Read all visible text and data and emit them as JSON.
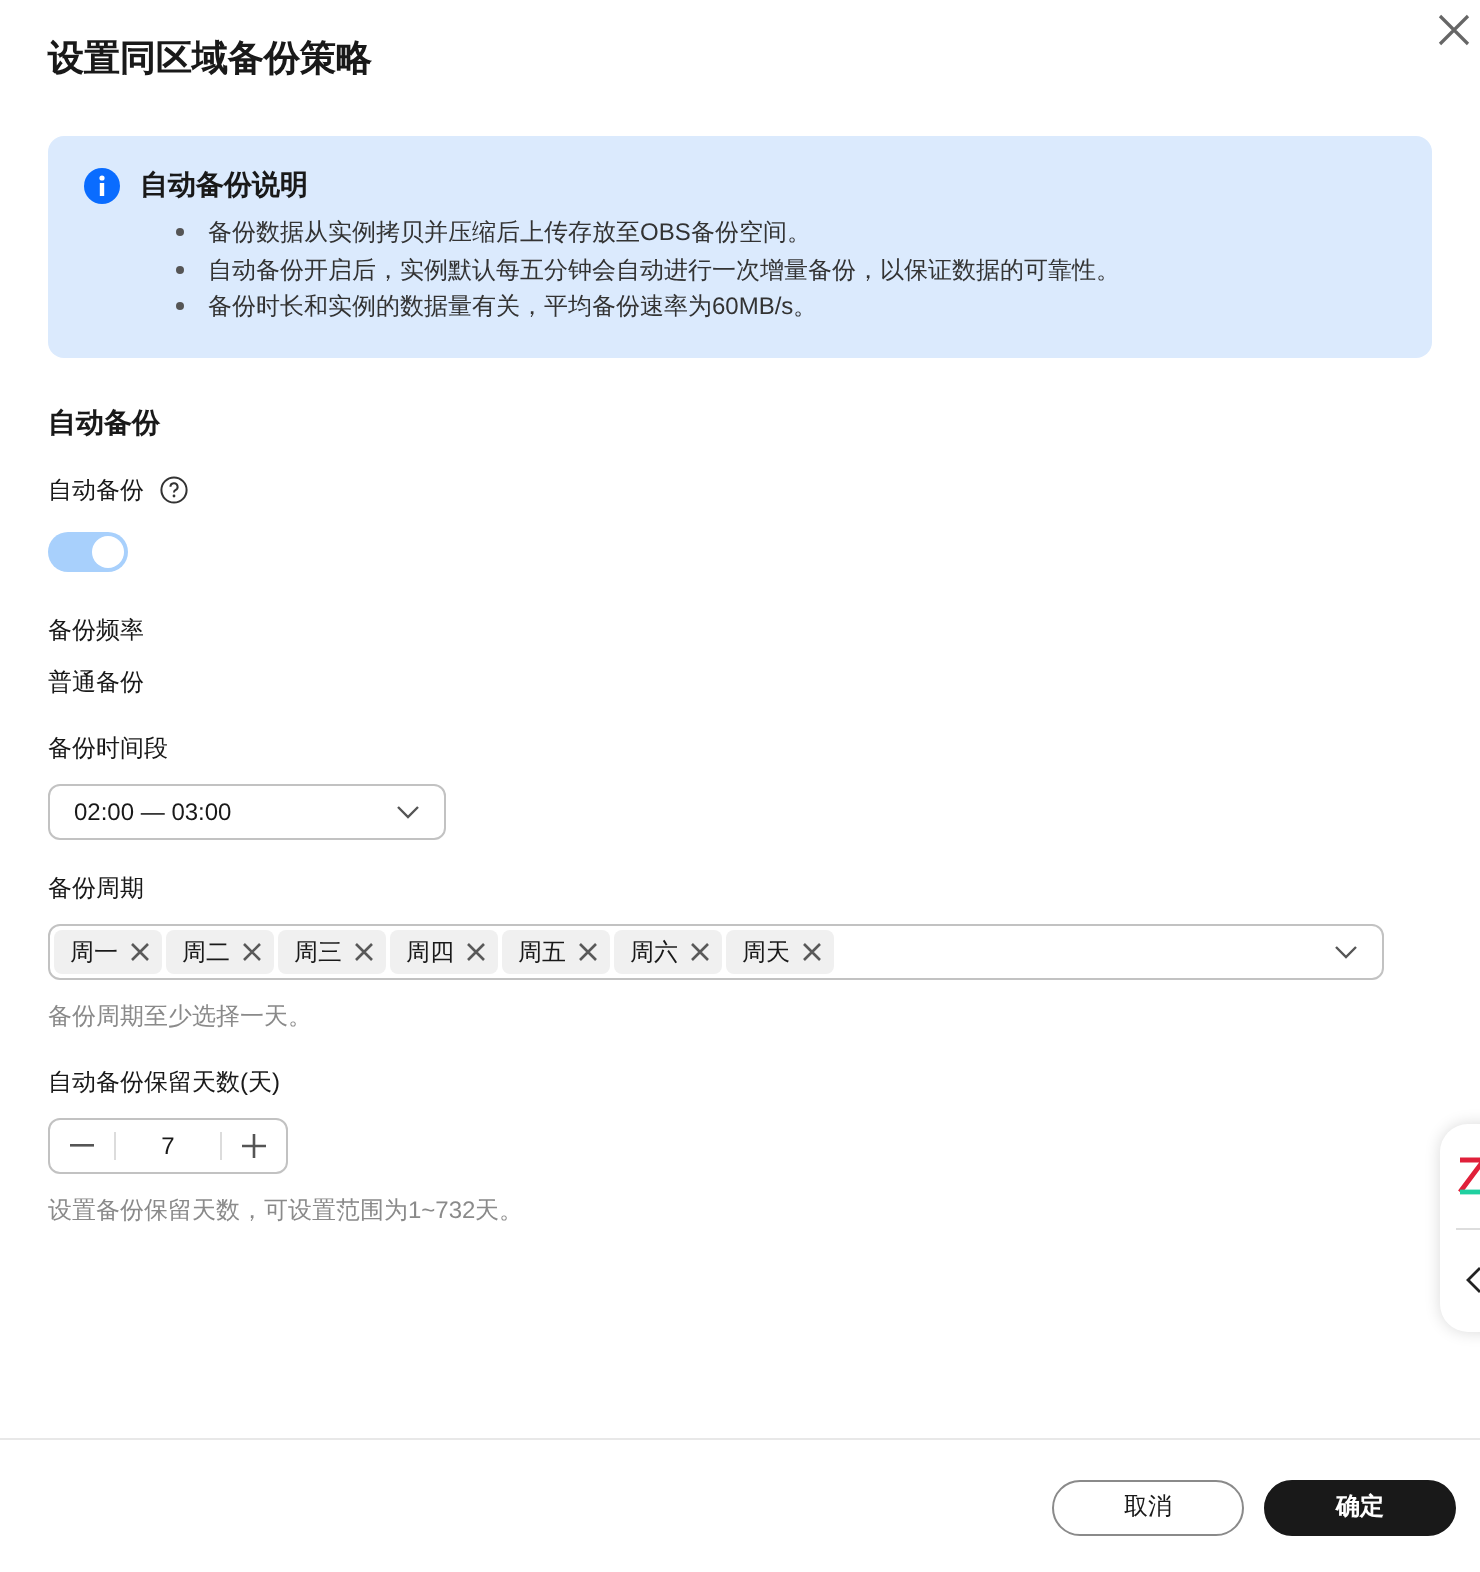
{
  "dialog": {
    "title": "设置同区域备份策略"
  },
  "notice": {
    "title": "自动备份说明",
    "items": [
      "备份数据从实例拷贝并压缩后上传存放至OBS备份空间。",
      "自动备份开启后，实例默认每五分钟会自动进行一次增量备份，以保证数据的可靠性。",
      "备份时长和实例的数据量有关，平均备份速率为60MB/s。"
    ]
  },
  "section": {
    "title": "自动备份"
  },
  "auto_backup": {
    "label": "自动备份",
    "on": true
  },
  "frequency": {
    "label": "备份频率",
    "value": "普通备份"
  },
  "time_window": {
    "label": "备份时间段",
    "value": "02:00 — 03:00"
  },
  "period": {
    "label": "备份周期",
    "tags": [
      "周一",
      "周二",
      "周三",
      "周四",
      "周五",
      "周六",
      "周天"
    ],
    "hint": "备份周期至少选择一天。"
  },
  "retention": {
    "label": "自动备份保留天数(天)",
    "value": "7",
    "hint": "设置备份保留天数，可设置范围为1~732天。"
  },
  "buttons": {
    "cancel": "取消",
    "confirm": "确定"
  }
}
